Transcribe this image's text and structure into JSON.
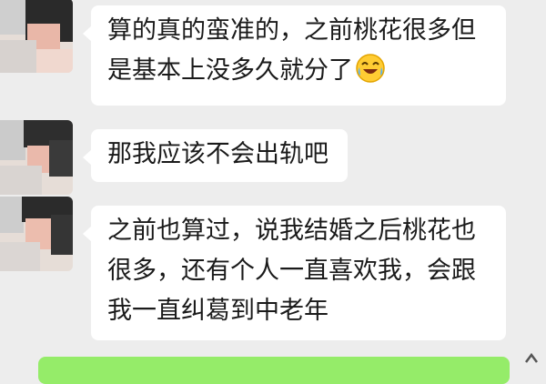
{
  "chat": {
    "messages": [
      {
        "sender": "other",
        "lines": [
          "算的真的蛮准的，之前桃花很多但",
          "是基本上没多久就分了"
        ],
        "emoji": "laughing-crying-emoji"
      },
      {
        "sender": "other",
        "lines": [
          "那我应该不会出轨吧"
        ]
      },
      {
        "sender": "other",
        "lines": [
          "之前也算过，说我结婚之后桃花也",
          "很多，还有个人一直喜欢我，会跟",
          "我一直纠葛到中老年"
        ]
      }
    ]
  },
  "colors": {
    "background": "#ededed",
    "bubble_incoming": "#ffffff",
    "bubble_outgoing": "#95ec69",
    "text": "#1a1a1a"
  }
}
